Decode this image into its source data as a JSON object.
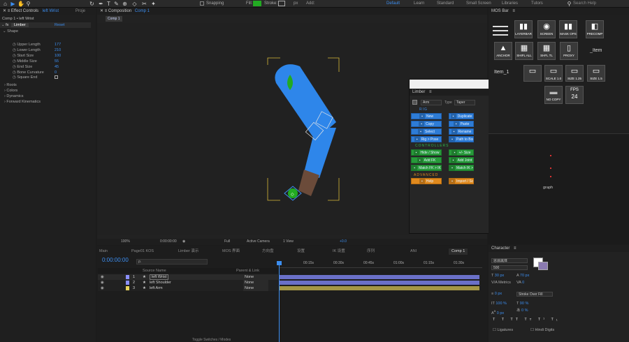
{
  "topbar": {
    "snapping_label": "Snapping",
    "fill_label": "Fill:",
    "stroke_label": "Stroke:",
    "stroke_px": "px",
    "add_label": "Add:",
    "workspaces": [
      "Default",
      "Learn",
      "Standard",
      "Small Screen",
      "Libraries",
      "Tutors"
    ],
    "search_placeholder": "Search Help"
  },
  "effect_controls": {
    "tab_label": "Effect Controls",
    "tab_target": "left Wrist",
    "project_tab": "Proje",
    "comp_path": "Comp 1 • left Wrist",
    "fx_label": "fx",
    "fx_name": "Limber",
    "reset_label": "Reset",
    "section_shape": "Shape",
    "properties": [
      {
        "label": "Upper Length",
        "value": "177"
      },
      {
        "label": "Lower Length",
        "value": "210"
      },
      {
        "label": "Start Size",
        "value": "100"
      },
      {
        "label": "Middle Size",
        "value": "55"
      },
      {
        "label": "End Size",
        "value": "45"
      },
      {
        "label": "Bone Curvature",
        "value": "0"
      },
      {
        "label": "Square End",
        "value": ""
      }
    ],
    "sections": [
      "Roots",
      "Colors",
      "Dynamics",
      "Forward Kinematics"
    ]
  },
  "composition": {
    "tab_label": "Composition",
    "tab_name": "Comp 1",
    "comp_tab": "Comp 1",
    "zoom": "100%",
    "timecode": "0:00:00:00",
    "resolution": "Full",
    "camera": "Active Camera",
    "views": "1 View",
    "exposure": "+0.0",
    "colors": {
      "arm": "#2e86ea",
      "hand": "#6b4b3a",
      "control": "#22aa22"
    }
  },
  "limber": {
    "title": "Limber",
    "side_label": "Arm",
    "type_label": "Type",
    "type_value": "Taper",
    "rig_section": "RIG",
    "rig_buttons": [
      "New",
      "Duplicate",
      "Copy",
      "Paste",
      "Select",
      "Rename",
      "Rig > Pose",
      "Path to Bone"
    ],
    "controllers_section": "CONTROLLERS",
    "controller_buttons": [
      "Hide / Show",
      "+/- Size",
      "Add FK",
      "Add Joint",
      "Match FK > IK",
      "Match IK > FK"
    ],
    "advanced_section": "ADVANCED",
    "advanced_buttons": [
      "Help",
      "Import / Script"
    ]
  },
  "mos_bar": {
    "title": "MOS Bar",
    "tiles_row1": [
      "LAYERBAR",
      "SCREEN",
      "MASK OPS",
      "PRECOMP"
    ],
    "tiles_row2": [
      "ANCHOR",
      "SHIFL ALL",
      "SHFL TL",
      "PROXY"
    ],
    "extra_label": "_Item",
    "item_label": "Item_1",
    "scale_labels": [
      "",
      "SCALE 1.0",
      "SIZE 1.25",
      "SIZE 1.5"
    ],
    "fps_label": "FPS",
    "fps_value": "24",
    "nocopy_label": "NO COPY"
  },
  "timeline": {
    "tabs": [
      "Main",
      "Page01 KOS",
      "Limber 演示",
      "MOS 界面",
      "方向盘",
      "设置",
      "IK 设置",
      "序列",
      "ANI",
      "Comp 1"
    ],
    "timecode": "0:00:00:00",
    "search_placeholder": "ρ.",
    "col_source": "Source Name",
    "col_parent": "Parent & Link",
    "ruler": [
      "00:15s",
      "00:30s",
      "00:45s",
      "01:00s",
      "01:15s",
      "01:30s"
    ],
    "layers": [
      {
        "num": "1",
        "name": "left Wrist",
        "parent": "None",
        "color": "#8a8fff"
      },
      {
        "num": "2",
        "name": "left Shoulder",
        "parent": "None",
        "color": "#8a8fff"
      },
      {
        "num": "3",
        "name": "left Arm",
        "parent": "None",
        "color": "#e7d35b"
      }
    ],
    "footer": "Toggle Switches / Modes"
  },
  "character": {
    "title": "Character",
    "font": "思源黑体",
    "style": "500",
    "size": "30 px",
    "leading": "70 px",
    "kerning": "Metrics",
    "tracking": "0",
    "stroke_width": "0 px",
    "stroke_mode": "Stroke Over Fill",
    "v_scale": "100 %",
    "h_scale": "90 %",
    "baseline": "0 px",
    "tsume": "0 %",
    "ligatures": "Ligatures",
    "hindi": "Hindi Digits",
    "graph_label": "graph"
  }
}
